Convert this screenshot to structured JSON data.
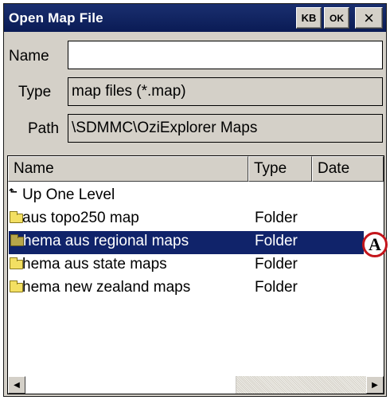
{
  "window": {
    "title": "Open Map File",
    "kb_label": "KB",
    "ok_label": "OK",
    "close_label": "×"
  },
  "form": {
    "name_label": "Name",
    "name_value": "",
    "type_label": "Type",
    "type_value": "map files (*.map)",
    "path_label": "Path",
    "path_value": "\\SDMMC\\OziExplorer Maps"
  },
  "list": {
    "columns": [
      "Name",
      "Type",
      "Date"
    ],
    "rows": [
      {
        "icon": "up-level-icon",
        "name": "Up One Level",
        "type": ""
      },
      {
        "icon": "folder-icon",
        "name": "aus topo250 map",
        "type": "Folder"
      },
      {
        "icon": "folder-icon",
        "name": "hema aus regional maps",
        "type": "Folder",
        "selected": true
      },
      {
        "icon": "folder-icon",
        "name": "hema aus state maps",
        "type": "Folder"
      },
      {
        "icon": "folder-icon",
        "name": "hema new zealand maps",
        "type": "Folder"
      }
    ]
  },
  "annotation": {
    "marker_label": "A",
    "border_color": "#c4161c"
  },
  "colors": {
    "title_bar": "#0a1b55",
    "selection": "#10236a",
    "chrome": "#d4d0c8"
  }
}
